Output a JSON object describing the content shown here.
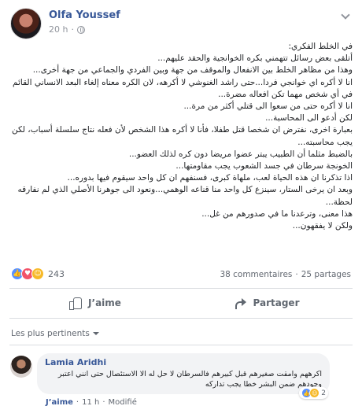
{
  "post": {
    "author": "Olfa Youssef",
    "time": "20 h",
    "separator": "·",
    "paragraphs": [
      "في الخلط الفكري:",
      "أتلقى بعض رسائل تتهمني بكره الخوانجية والحقد عليهم...",
      "وهذا من مظاهر الخلط بين الانفعال والموقف من جهة وبين الفردي والجماعي من جهة أخرى...",
      "انا لا أكره اي خوانجي فردا...حتى راشد الغنوشي لا أكرهه، لان الكره معناه إلغاء البعد الانساني القائم في أي شخص مهما تكن افعاله مضرة...",
      "انا لا أكره حتى من سعوا الى قتلي أكثر من مرة...",
      "لكن أدعو الى المحاسبة...",
      "بعبارة اخرى، نفترض ان شخصا قتل طفلا، فأنا لا أكره هذا الشخص لأن فعله نتاج سلسلة أسباب، لكن يجب محاسبته...",
      "بالضبط مثلما أن الطبيب يبتر عضوا مريضا دون كره لذلك العضو...",
      "الخونجة سرطان في جسد الشعوب يجب مقاومتها...",
      "اذا تذكرنا ان هذه الحياة لعب، ملهاة كبرى، فسنفهم ان كل واحد سيقوم فيها بدوره...",
      "وبعد ان يرخى الستار، سينزع كل واحد منا قناعه الوهمي...ونعود الى جوهرنا الأصلي الذي لم نفارقه لحظة...",
      "هذا معنى، وترعدنا ما في صدورهم من غل...",
      "ولكن لا يفقهون..."
    ]
  },
  "reactions": {
    "count": "243",
    "types": [
      "like",
      "love",
      "haha"
    ],
    "comments": "38 commentaires",
    "shares": "25 partages",
    "stats_separator": "·"
  },
  "actions": {
    "like": "J’aime",
    "share": "Partager"
  },
  "comments": {
    "sort_label": "Les plus pertinents",
    "items": [
      {
        "author": "Lamia Aridhi",
        "text": "اكرههم وامقت صغيرهم قبل كبيرهم فالسرطان لا حل له الا الاستئصال حتى انني اعتبر وجودهم ضمن البشر خطا يجب تداركه",
        "reaction_count": "2",
        "like": "J’aime",
        "time": "11 h",
        "edited": "Modifié",
        "separator": "·"
      }
    ]
  },
  "colors": {
    "link": "#385898",
    "meta": "#90949c",
    "like": "#5890ff",
    "love": "#f25268",
    "haha": "#f7b928"
  }
}
